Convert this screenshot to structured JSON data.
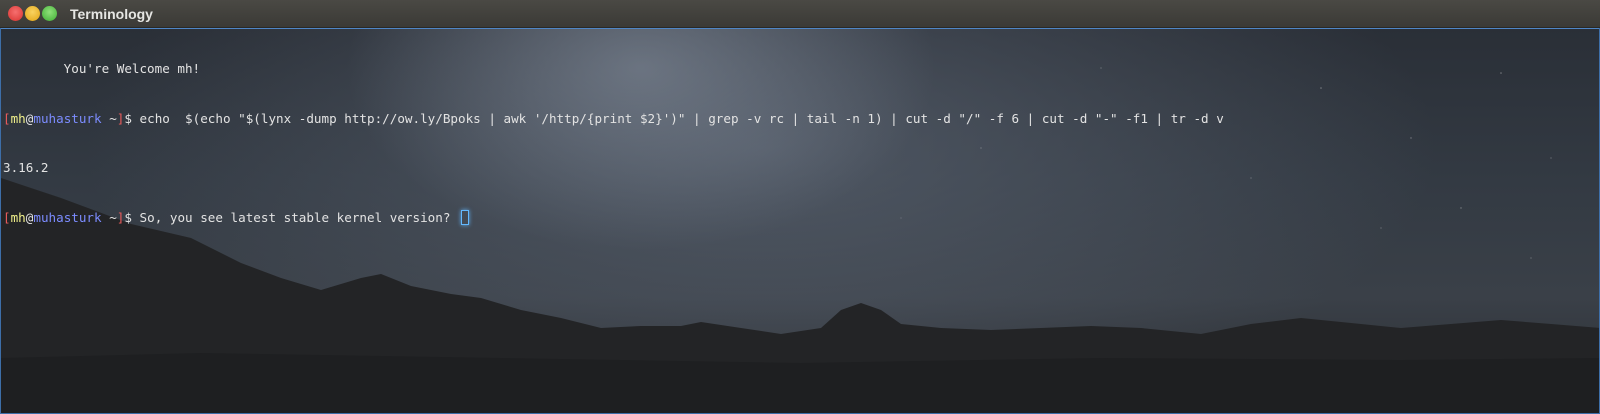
{
  "window": {
    "title": "Terminology",
    "controls": {
      "close_icon": "×",
      "minimize_icon": "−",
      "maximize_icon": "+"
    }
  },
  "terminal": {
    "welcome": "        You're Welcome mh!",
    "prompt": {
      "open_bracket": "[",
      "user": "mh",
      "at": "@",
      "host": "muhasturk",
      "path": " ~",
      "close_bracket": "]",
      "dollar": "$ "
    },
    "command_1": "echo  $(echo \"$(lynx -dump http://ow.ly/Bpoks | awk '/http/{print $2}')\" | grep -v rc | tail -n 1) | cut -d \"/\" -f 6 | cut -d \"-\" -f1 | tr -d v",
    "output_1": "3.16.2",
    "command_2": "So, you see latest stable kernel version? "
  },
  "colors": {
    "prompt_bracket": "#ea5b5b",
    "prompt_user": "#f1f18a",
    "prompt_host": "#7c8cff",
    "cursor": "#63b8ff",
    "window_border": "#3d6ea8"
  }
}
